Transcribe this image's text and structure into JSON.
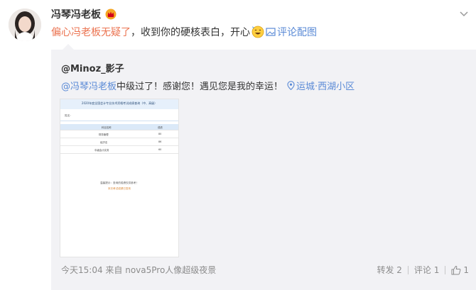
{
  "author": {
    "name": "冯琴冯老板"
  },
  "post": {
    "mention": "偏心冯老板无疑了",
    "body": "，收到你的硬核表白，开心",
    "link": "评论配图"
  },
  "retweet": {
    "author": "@Minoz_影子",
    "mention": "@冯琴冯老板",
    "text": " 中级过了！感谢您！遇见您是我的幸运！",
    "location": "运城·西湖小区"
  },
  "thumbnail": {
    "title": "2020年度全国会计专业技术资格考试成绩查询（中、高级）",
    "name_label": "姓名：",
    "table_header": [
      "科目名称",
      "成绩"
    ],
    "rows": [
      [
        "财务管理",
        "80"
      ],
      [
        "经济法",
        "86"
      ],
      [
        "中级会计实务",
        "60"
      ]
    ],
    "notice": "温馨提示：查询的成绩仅供参考！",
    "notice2": "本次考试成绩已发布"
  },
  "footer": {
    "meta": "今天15:04 来自 nova5Pro人像超级夜景"
  },
  "actions": {
    "repost": "转发 2",
    "comment": "评论 1",
    "like": "1"
  },
  "icons": {
    "vip": "vip-crown-icon",
    "menu": "chevron-down-icon",
    "emoji": "happy-face-icon",
    "location": "location-pin-icon",
    "like": "thumbs-up-icon"
  },
  "colors": {
    "link": "#5a8ad6",
    "mention": "#eb7350",
    "retweet_bg": "#f2f2f5"
  }
}
